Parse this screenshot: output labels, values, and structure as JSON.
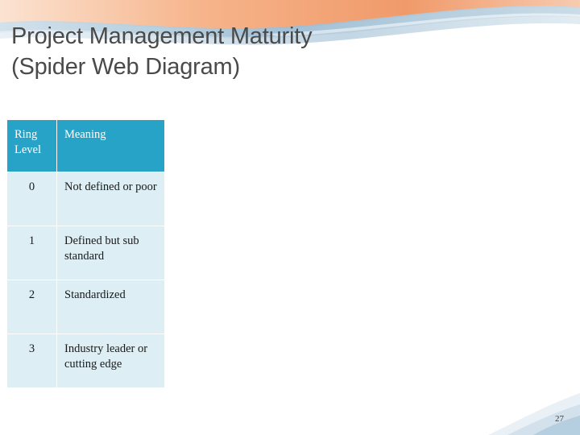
{
  "slide": {
    "title_lines": [
      "Project Management Maturity",
      "(Spider Web Diagram)"
    ],
    "page_number": "27",
    "colors": {
      "header_fill": "#28a3c8",
      "row_fill": "#ddeef4",
      "title_text": "#4a4a4a",
      "decor_peach": "#f6b48a",
      "decor_blue": "#8fb6cf"
    }
  },
  "table": {
    "headers": [
      "Ring Level",
      "Meaning"
    ],
    "header_level_line1": "Ring",
    "header_level_line2": "Level",
    "rows": [
      {
        "level": "0",
        "meaning": "Not defined or poor"
      },
      {
        "level": "1",
        "meaning": "Defined but sub standard"
      },
      {
        "level": "2",
        "meaning": "Standardized"
      },
      {
        "level": "3",
        "meaning": "Industry leader or cutting edge"
      }
    ]
  }
}
